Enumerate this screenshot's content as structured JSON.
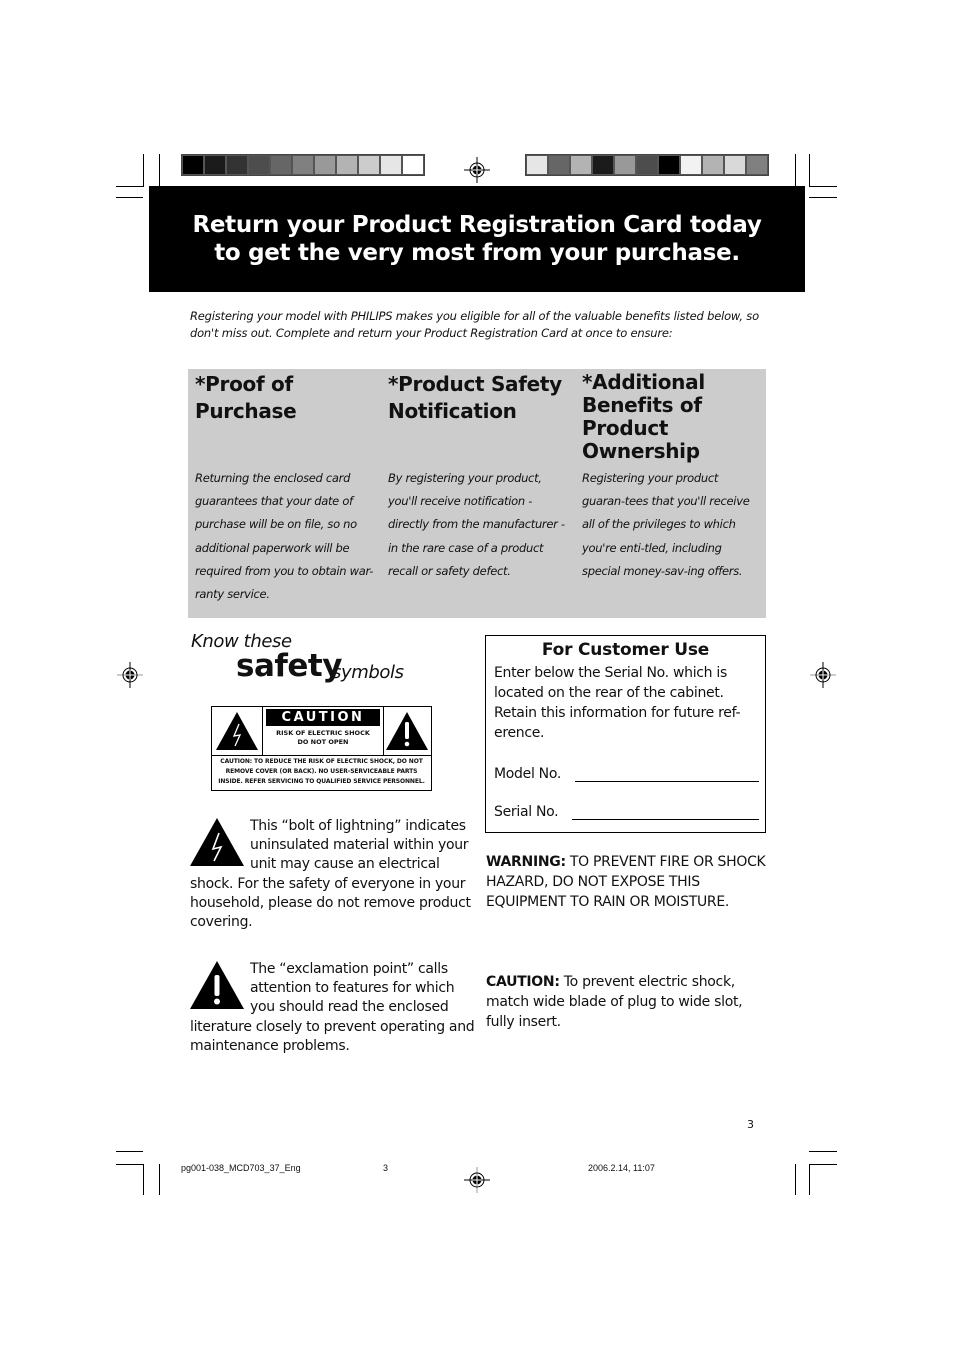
{
  "print_marks": {
    "color_bar_left": [
      "#000000",
      "#1b1b1b",
      "#333333",
      "#4d4d4d",
      "#666666",
      "#808080",
      "#999999",
      "#b3b3b3",
      "#cccccc",
      "#e6e6e6",
      "#ffffff"
    ],
    "color_bar_right": [
      "#e6e6e6",
      "#666666",
      "#b3b3b3",
      "#1b1b1b",
      "#999999",
      "#4d4d4d",
      "#000000",
      "#f2f2f2",
      "#b3b3b3",
      "#d9d9d9",
      "#808080"
    ]
  },
  "header": {
    "line1": "Return your Product Registration Card today",
    "line2": "to get the very most from your purchase."
  },
  "intro": "Registering your model with PHILIPS makes you eligible for all of the valuable benefits listed below, so don't miss out. Complete and return your Product Registration Card at once to ensure:",
  "benefits": [
    {
      "title": "*Proof of Purchase",
      "body": "Returning the enclosed card guarantees that your date of purchase will be on file, so no additional paperwork will be required from you to obtain war-ranty service."
    },
    {
      "title": "*Product Safety Notification",
      "body": "By registering your product, you'll receive notification - directly from the manufacturer - in the rare case of a product recall or safety defect."
    },
    {
      "title": "*Additional Benefits of Product Ownership",
      "body": "Registering your product guaran-tees that you'll receive all of the privileges to which you're enti-tled, including special money-sav-ing offers."
    }
  ],
  "safety_heading": {
    "know": "Know these",
    "safety": "safety",
    "symbols": "symbols"
  },
  "caution_label": {
    "title": "CAUTION",
    "risk_line1": "RISK OF ELECTRIC SHOCK",
    "risk_line2": "DO NOT OPEN",
    "bottom_line1": "CAUTION: TO REDUCE THE RISK OF ELECTRIC SHOCK, DO NOT",
    "bottom_line2": "REMOVE COVER (OR BACK). NO USER-SERVICEABLE PARTS",
    "bottom_line3": "INSIDE. REFER SERVICING TO QUALIFIED SERVICE PERSONNEL."
  },
  "lightning_text": "This “bolt of lightning” indicates uninsulated material within your unit may cause an electrical shock. For the safety of everyone in your household, please do not remove product covering.",
  "exclamation_text": "The “exclamation point” calls attention to features for which you should read the enclosed literature closely to prevent operating and maintenance problems.",
  "customer_use": {
    "title": "For Customer Use",
    "instructions": "Enter below the Serial No. which is located on the rear of the cabinet. Retain this information for future ref-erence.",
    "model_label": "Model No.",
    "model_value": "",
    "serial_label": "Serial No.",
    "serial_value": ""
  },
  "warning": {
    "label": "WARNING:",
    "text": " TO PREVENT FIRE OR SHOCK HAZARD, DO NOT EXPOSE THIS EQUIPMENT TO RAIN OR MOISTURE."
  },
  "caution": {
    "label": "CAUTION:",
    "text": " To prevent electric shock, match wide blade of plug to wide slot, fully insert."
  },
  "page_number": "3",
  "slug": {
    "file": "pg001-038_MCD703_37_Eng",
    "page": "3",
    "date": "2006.2.14, 11:07"
  }
}
